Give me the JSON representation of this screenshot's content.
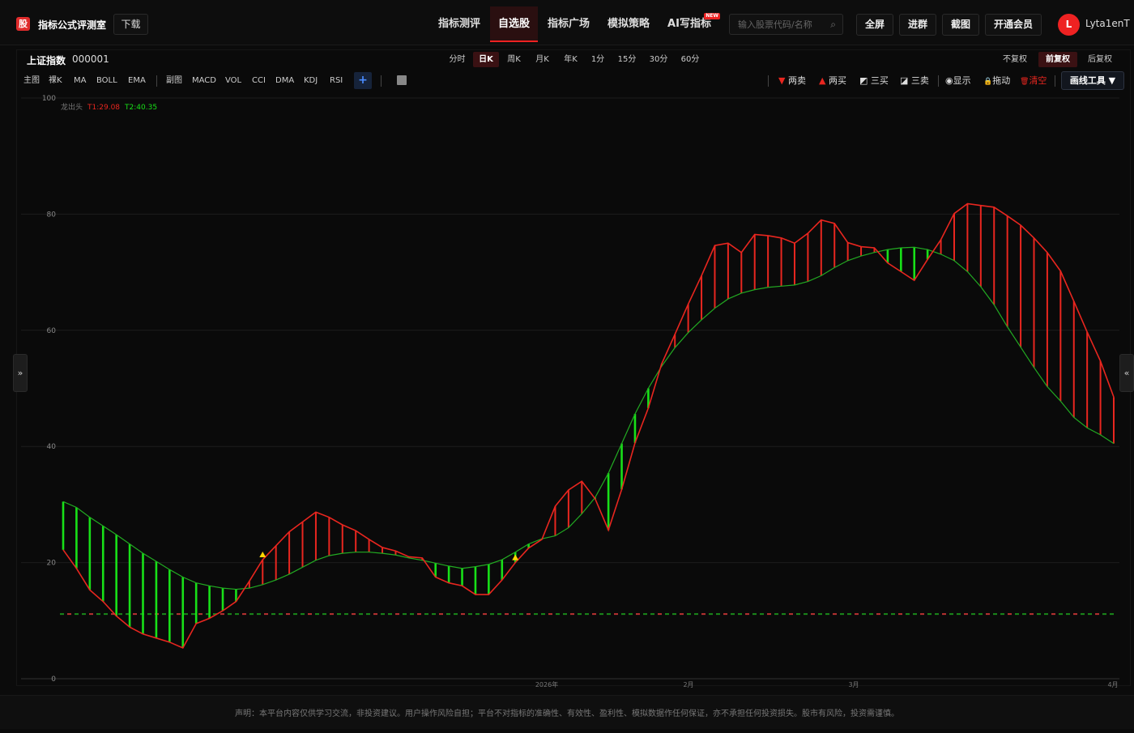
{
  "header": {
    "logo_char": "股",
    "app_title": "指标公式评测室",
    "download_label": "下载",
    "nav": [
      {
        "label": "指标测评",
        "active": false
      },
      {
        "label": "自选股",
        "active": true
      },
      {
        "label": "指标广场",
        "active": false
      },
      {
        "label": "模拟策略",
        "active": false
      },
      {
        "label": "AI写指标",
        "active": false,
        "badge": "NEW"
      }
    ],
    "search_placeholder": "输入股票代码/名称",
    "buttons": [
      "全屏",
      "进群",
      "截图",
      "开通会员"
    ],
    "avatar_letter": "L",
    "username": "Lyta1enT"
  },
  "symbol": {
    "name": "上证指数",
    "code": "000001"
  },
  "periods": [
    {
      "label": "分时",
      "active": false
    },
    {
      "label": "日K",
      "active": true
    },
    {
      "label": "周K",
      "active": false
    },
    {
      "label": "月K",
      "active": false
    },
    {
      "label": "年K",
      "active": false
    },
    {
      "label": "1分",
      "active": false
    },
    {
      "label": "15分",
      "active": false
    },
    {
      "label": "30分",
      "active": false
    },
    {
      "label": "60分",
      "active": false
    }
  ],
  "adjust": [
    {
      "label": "不复权",
      "active": false
    },
    {
      "label": "前复权",
      "active": true
    },
    {
      "label": "后复权",
      "active": false
    }
  ],
  "indicators_main": [
    "主图",
    "裸K",
    "MA",
    "BOLL",
    "EMA"
  ],
  "indicators_sub": [
    "副图",
    "MACD",
    "VOL",
    "CCI",
    "DMA",
    "KDJ",
    "RSI"
  ],
  "plus_label": "+",
  "tools": [
    {
      "icon": "▼",
      "label": "两卖",
      "color": "#e8261f"
    },
    {
      "icon": "▲",
      "label": "两买",
      "color": "#e8261f"
    },
    {
      "icon": "◩",
      "label": "三买",
      "color": "#dddddd"
    },
    {
      "icon": "◪",
      "label": "三卖",
      "color": "#dddddd"
    },
    {
      "icon": "◉",
      "label": "显示",
      "color": "#dddddd"
    },
    {
      "icon": "🔒",
      "label": "拖动",
      "color": "#dddddd"
    },
    {
      "icon": "🗑",
      "label": "清空",
      "color": "#e8261f"
    }
  ],
  "draw_tools_label": "画线工具 ▼",
  "side_left": "»",
  "side_right": "«",
  "legend": {
    "name": "龙出头",
    "t1": "T1:29.08",
    "t2": "T2:40.35"
  },
  "colors": {
    "up": "#e8261f",
    "down": "#18e018",
    "accent": "#e22a2a",
    "green_line": "#22aa22"
  },
  "footer_text": "声明：本平台内容仅供学习交流，非投资建议。用户操作风险自担；平台不对指标的准确性、有效性、盈利性、模拟数据作任何保证，亦不承担任何投资损失。股市有风险，投资需谨慎。",
  "chart_data": {
    "type": "line",
    "ylim": [
      0,
      100
    ],
    "y_ticks": [
      0,
      20,
      40,
      60,
      80,
      100
    ],
    "x_labels": [
      "2026年",
      "2月",
      "3月",
      "4月"
    ],
    "grid": true,
    "series": [
      {
        "name": "T1",
        "values": [
          30.5,
          29.5,
          27.8,
          26.3,
          24.8,
          23.2,
          21.6,
          20.2,
          18.8,
          17.5,
          16.5,
          16.0,
          15.6,
          15.4,
          15.6,
          16.2,
          17.0,
          18.0,
          19.2,
          20.4,
          21.2,
          21.6,
          21.8,
          21.8,
          21.6,
          21.3,
          20.8,
          20.4,
          19.9,
          19.4,
          19.0,
          19.3,
          19.7,
          20.5,
          21.8,
          23.2,
          24.1,
          24.6,
          26.0,
          28.4,
          31.2,
          35.4,
          40.5,
          45.6,
          50.0,
          53.8,
          57.0,
          59.6,
          61.8,
          63.8,
          65.4,
          66.4,
          67.0,
          67.4,
          67.6,
          67.8,
          68.4,
          69.4,
          70.8,
          72.0,
          72.8,
          73.4,
          73.9,
          74.2,
          74.3,
          73.9,
          73.1,
          72.0,
          70.1,
          67.5,
          64.4,
          60.6,
          57.1,
          53.6,
          50.3,
          47.8,
          45.0,
          43.2,
          42.0,
          40.5
        ]
      },
      {
        "name": "T2",
        "values": [
          22.2,
          19.0,
          15.3,
          13.3,
          10.8,
          8.9,
          7.7,
          7.0,
          6.3,
          5.3,
          9.5,
          10.4,
          11.7,
          13.3,
          16.8,
          20.5,
          22.9,
          25.3,
          27.0,
          28.7,
          27.8,
          26.5,
          25.5,
          24.0,
          22.6,
          22.0,
          21.0,
          20.8,
          17.5,
          16.5,
          16.0,
          14.5,
          14.5,
          17.0,
          20.0,
          22.5,
          24.0,
          29.7,
          32.5,
          34.0,
          31.0,
          25.6,
          32.6,
          40.6,
          46.6,
          54.2,
          59.3,
          64.5,
          69.4,
          74.6,
          75.0,
          73.4,
          76.5,
          76.3,
          75.9,
          75.0,
          76.7,
          79.0,
          78.4,
          75.1,
          74.4,
          74.2,
          71.6,
          70.1,
          68.6,
          72.2,
          75.6,
          80.1,
          81.8,
          81.5,
          81.2,
          79.7,
          78.1,
          75.9,
          73.4,
          70.2,
          65.0,
          59.7,
          54.7,
          48.5
        ]
      }
    ],
    "baseline_value": 11
  }
}
